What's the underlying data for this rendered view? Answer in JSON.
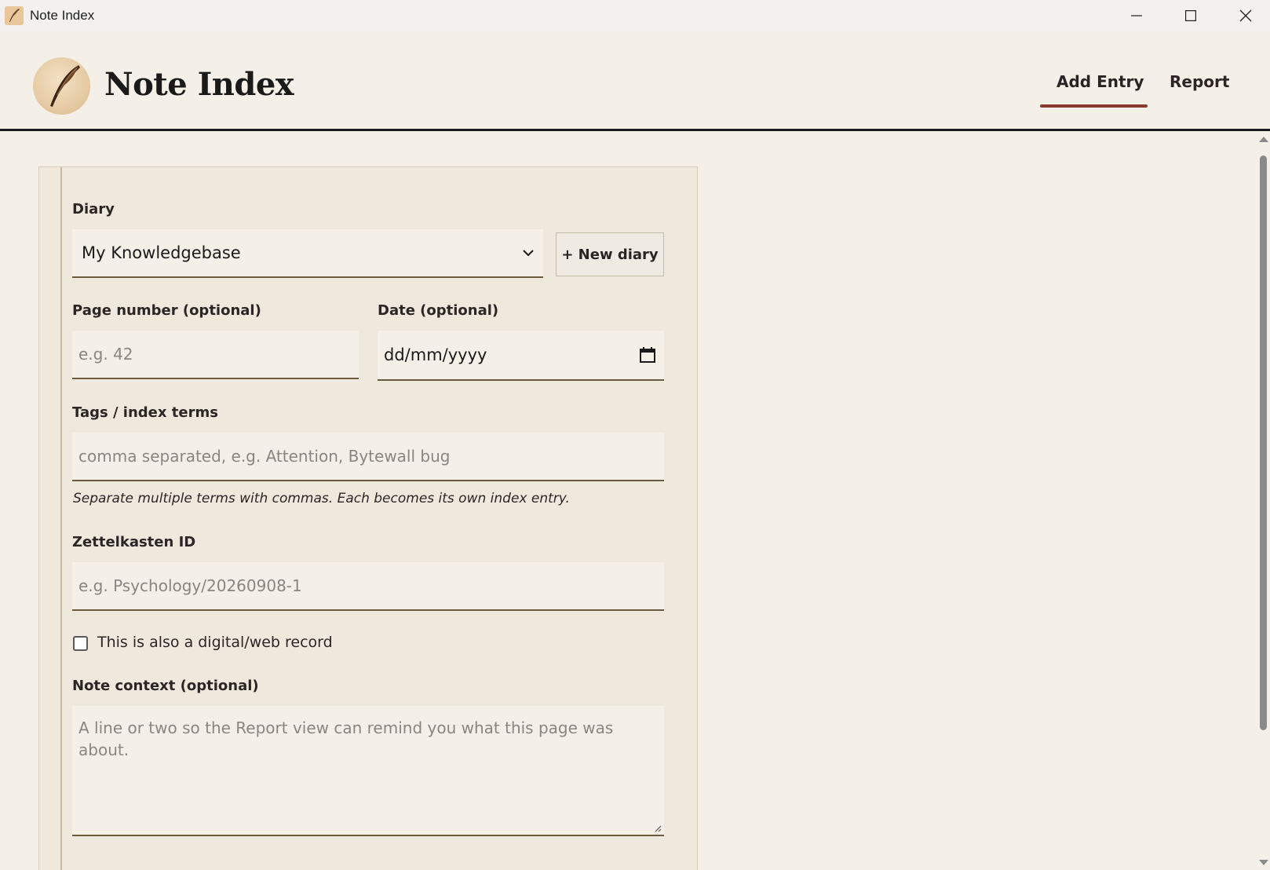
{
  "window": {
    "title": "Note Index"
  },
  "header": {
    "title": "Note Index",
    "tabs": [
      {
        "label": "Add Entry",
        "active": true
      },
      {
        "label": "Report",
        "active": false
      }
    ]
  },
  "form": {
    "diary": {
      "label": "Diary",
      "selected": "My Knowledgebase",
      "new_button": "+ New diary"
    },
    "page_number": {
      "label": "Page number (optional)",
      "placeholder": "e.g. 42"
    },
    "date": {
      "label": "Date (optional)",
      "placeholder": "dd/mm/yyyy"
    },
    "tags": {
      "label": "Tags / index terms",
      "placeholder": "comma separated, e.g. Attention, Bytewall bug",
      "hint": "Separate multiple terms with commas. Each becomes its own index entry."
    },
    "zettelkasten": {
      "label": "Zettelkasten ID",
      "placeholder": "e.g. Psychology/20260908-1"
    },
    "digital_record": {
      "label": "This is also a digital/web record",
      "checked": false
    },
    "note_context": {
      "label": "Note context (optional)",
      "placeholder": "A line or two so the Report view can remind you what this page was about."
    }
  },
  "colors": {
    "accent": "#8b3a2f",
    "background": "#f4efe7",
    "card": "#efe9dd",
    "field_border": "#6b5a3e"
  }
}
